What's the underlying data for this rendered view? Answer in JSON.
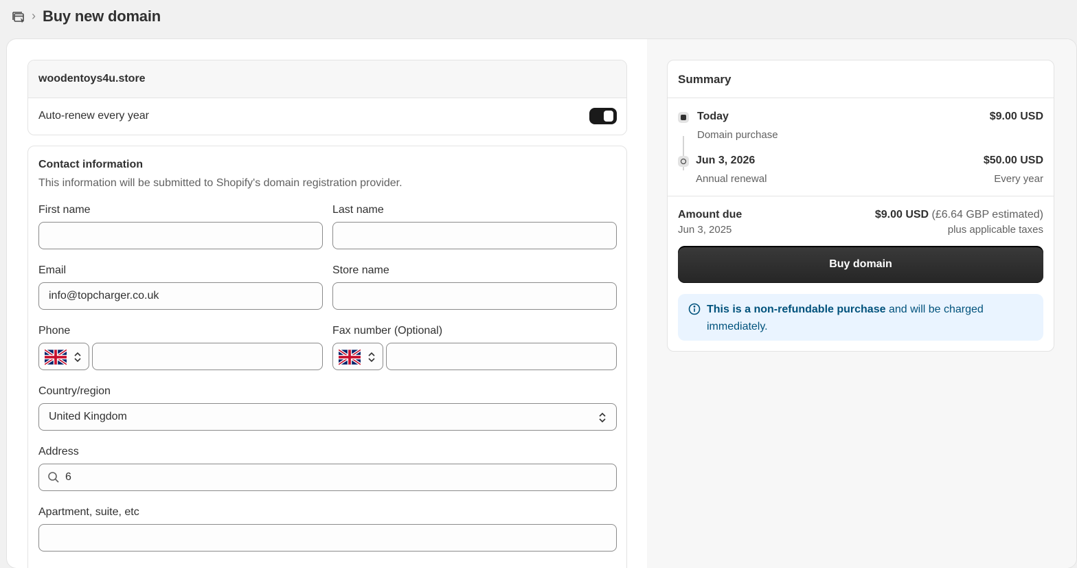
{
  "breadcrumb": {
    "icon": "domains-icon",
    "separator": "›",
    "title": "Buy new domain"
  },
  "domain": {
    "name": "woodentoys4u.store",
    "auto_renew_label": "Auto-renew every year",
    "auto_renew_on": true
  },
  "contact": {
    "title": "Contact information",
    "description": "This information will be submitted to Shopify's domain registration provider.",
    "first_name": {
      "label": "First name",
      "value": ""
    },
    "last_name": {
      "label": "Last name",
      "value": ""
    },
    "email": {
      "label": "Email",
      "value": "info@topcharger.co.uk"
    },
    "store_name": {
      "label": "Store name",
      "value": ""
    },
    "phone": {
      "label": "Phone",
      "country_flag": "uk-flag",
      "value": ""
    },
    "fax": {
      "label": "Fax number (Optional)",
      "country_flag": "uk-flag",
      "value": ""
    },
    "country": {
      "label": "Country/region",
      "value": "United Kingdom"
    },
    "address": {
      "label": "Address",
      "value": "6"
    },
    "apartment": {
      "label": "Apartment, suite, etc",
      "value": ""
    }
  },
  "summary": {
    "title": "Summary",
    "timeline": [
      {
        "date": "Today",
        "desc": "Domain purchase",
        "amount": "$9.00 USD",
        "note": ""
      },
      {
        "date": "Jun 3, 2026",
        "desc": "Annual renewal",
        "amount": "$50.00 USD",
        "note": "Every year"
      }
    ],
    "amount_due_label": "Amount due",
    "amount_due_date": "Jun 3, 2025",
    "amount_due_value": "$9.00 USD",
    "amount_due_estimate": "(£6.64 GBP estimated)",
    "amount_due_taxes": "plus applicable taxes",
    "buy_button": "Buy domain",
    "notice_bold": "This is a non-refundable purchase",
    "notice_rest": " and will be charged immediately."
  },
  "colors": {
    "page_bg": "#f1f1f1",
    "primary_button": "#303030",
    "notice_bg": "#eaf4ff",
    "notice_text": "#00527c"
  }
}
